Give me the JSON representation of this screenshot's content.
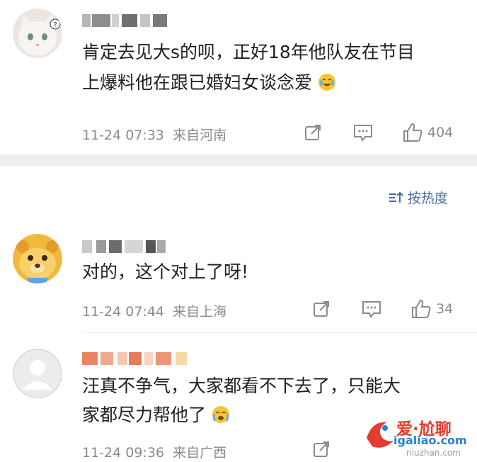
{
  "comments": [
    {
      "text_line1": "肯定去见大s的呗，正好18年他队友在节目",
      "text_line2": "上爆料他在跟已婚妇女谈念爱",
      "timestamp": "11-24 07:33",
      "location": "来自河南",
      "likes": "404"
    },
    {
      "text_line1": "对的，这个对上了呀!",
      "timestamp": "11-24 07:44",
      "location": "来自上海",
      "likes": "34"
    },
    {
      "text_line1": "汪真不争气，大家都看不下去了，只能大",
      "text_line2": "家都尽力帮他了",
      "timestamp": "11-24 09:36",
      "location": "来自广西",
      "likes": ""
    }
  ],
  "sort": {
    "label": "按热度"
  },
  "watermark": {
    "brand": "爱·尬聊",
    "url": "igaliao.com",
    "site": "niuzhan.com"
  },
  "colors": {
    "link": "#4a6a93",
    "meta": "#8b8b8b",
    "divider": "#efefef"
  }
}
